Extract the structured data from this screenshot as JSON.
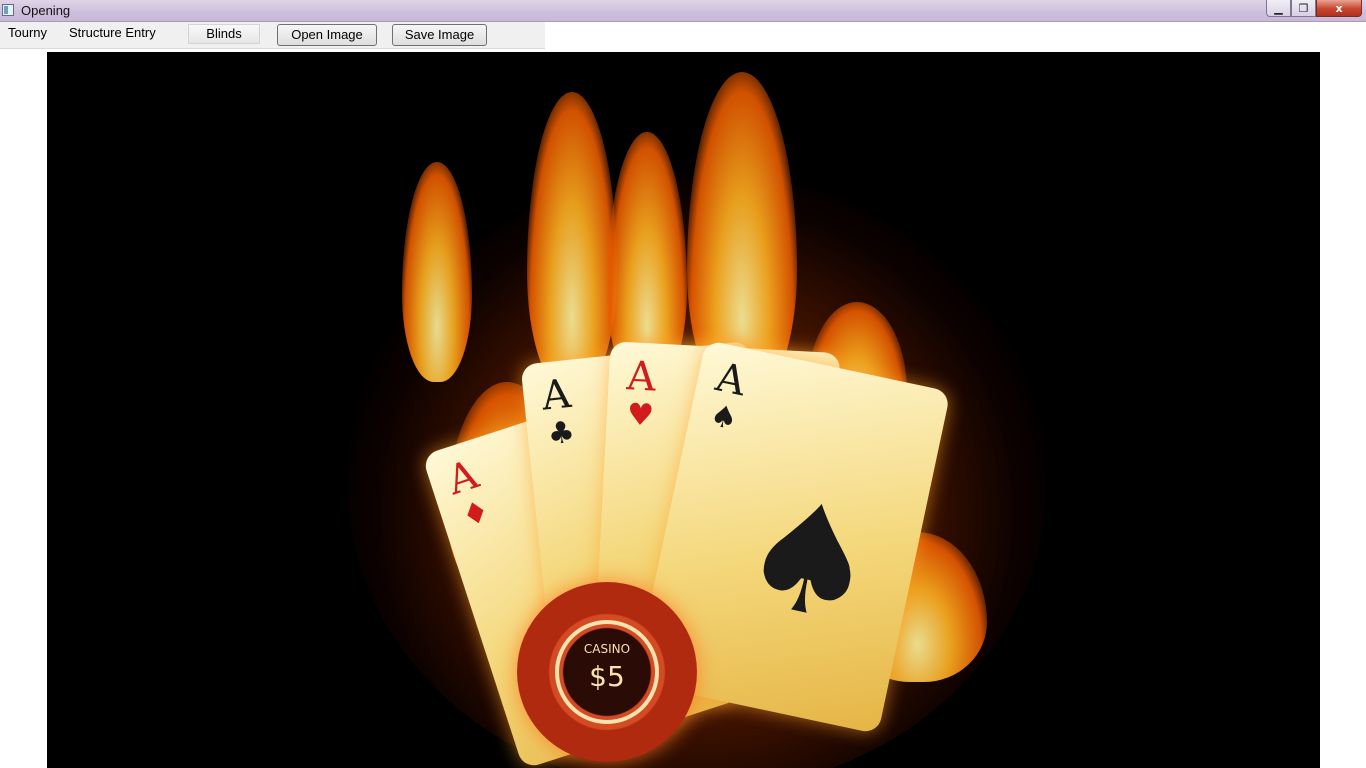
{
  "window": {
    "title": "Opening",
    "minimize_label": "▁",
    "maximize_label": "❐",
    "close_label": "x"
  },
  "menu": {
    "tourny": "Tourny",
    "structure_entry": "Structure Entry",
    "blinds": "Blinds"
  },
  "toolbar": {
    "open_image": "Open Image",
    "save_image": "Save Image"
  },
  "image": {
    "chip_label": "CASINO",
    "chip_value": "$5",
    "cards": [
      {
        "rank": "A",
        "suit": "♦"
      },
      {
        "rank": "A",
        "suit": "♣"
      },
      {
        "rank": "A",
        "suit": "♥"
      },
      {
        "rank": "A",
        "suit": "♠"
      }
    ],
    "colors": {
      "background": "#000000",
      "flame": "#ff8a00",
      "card": "#f7e49a",
      "chip": "#c8401c"
    }
  }
}
